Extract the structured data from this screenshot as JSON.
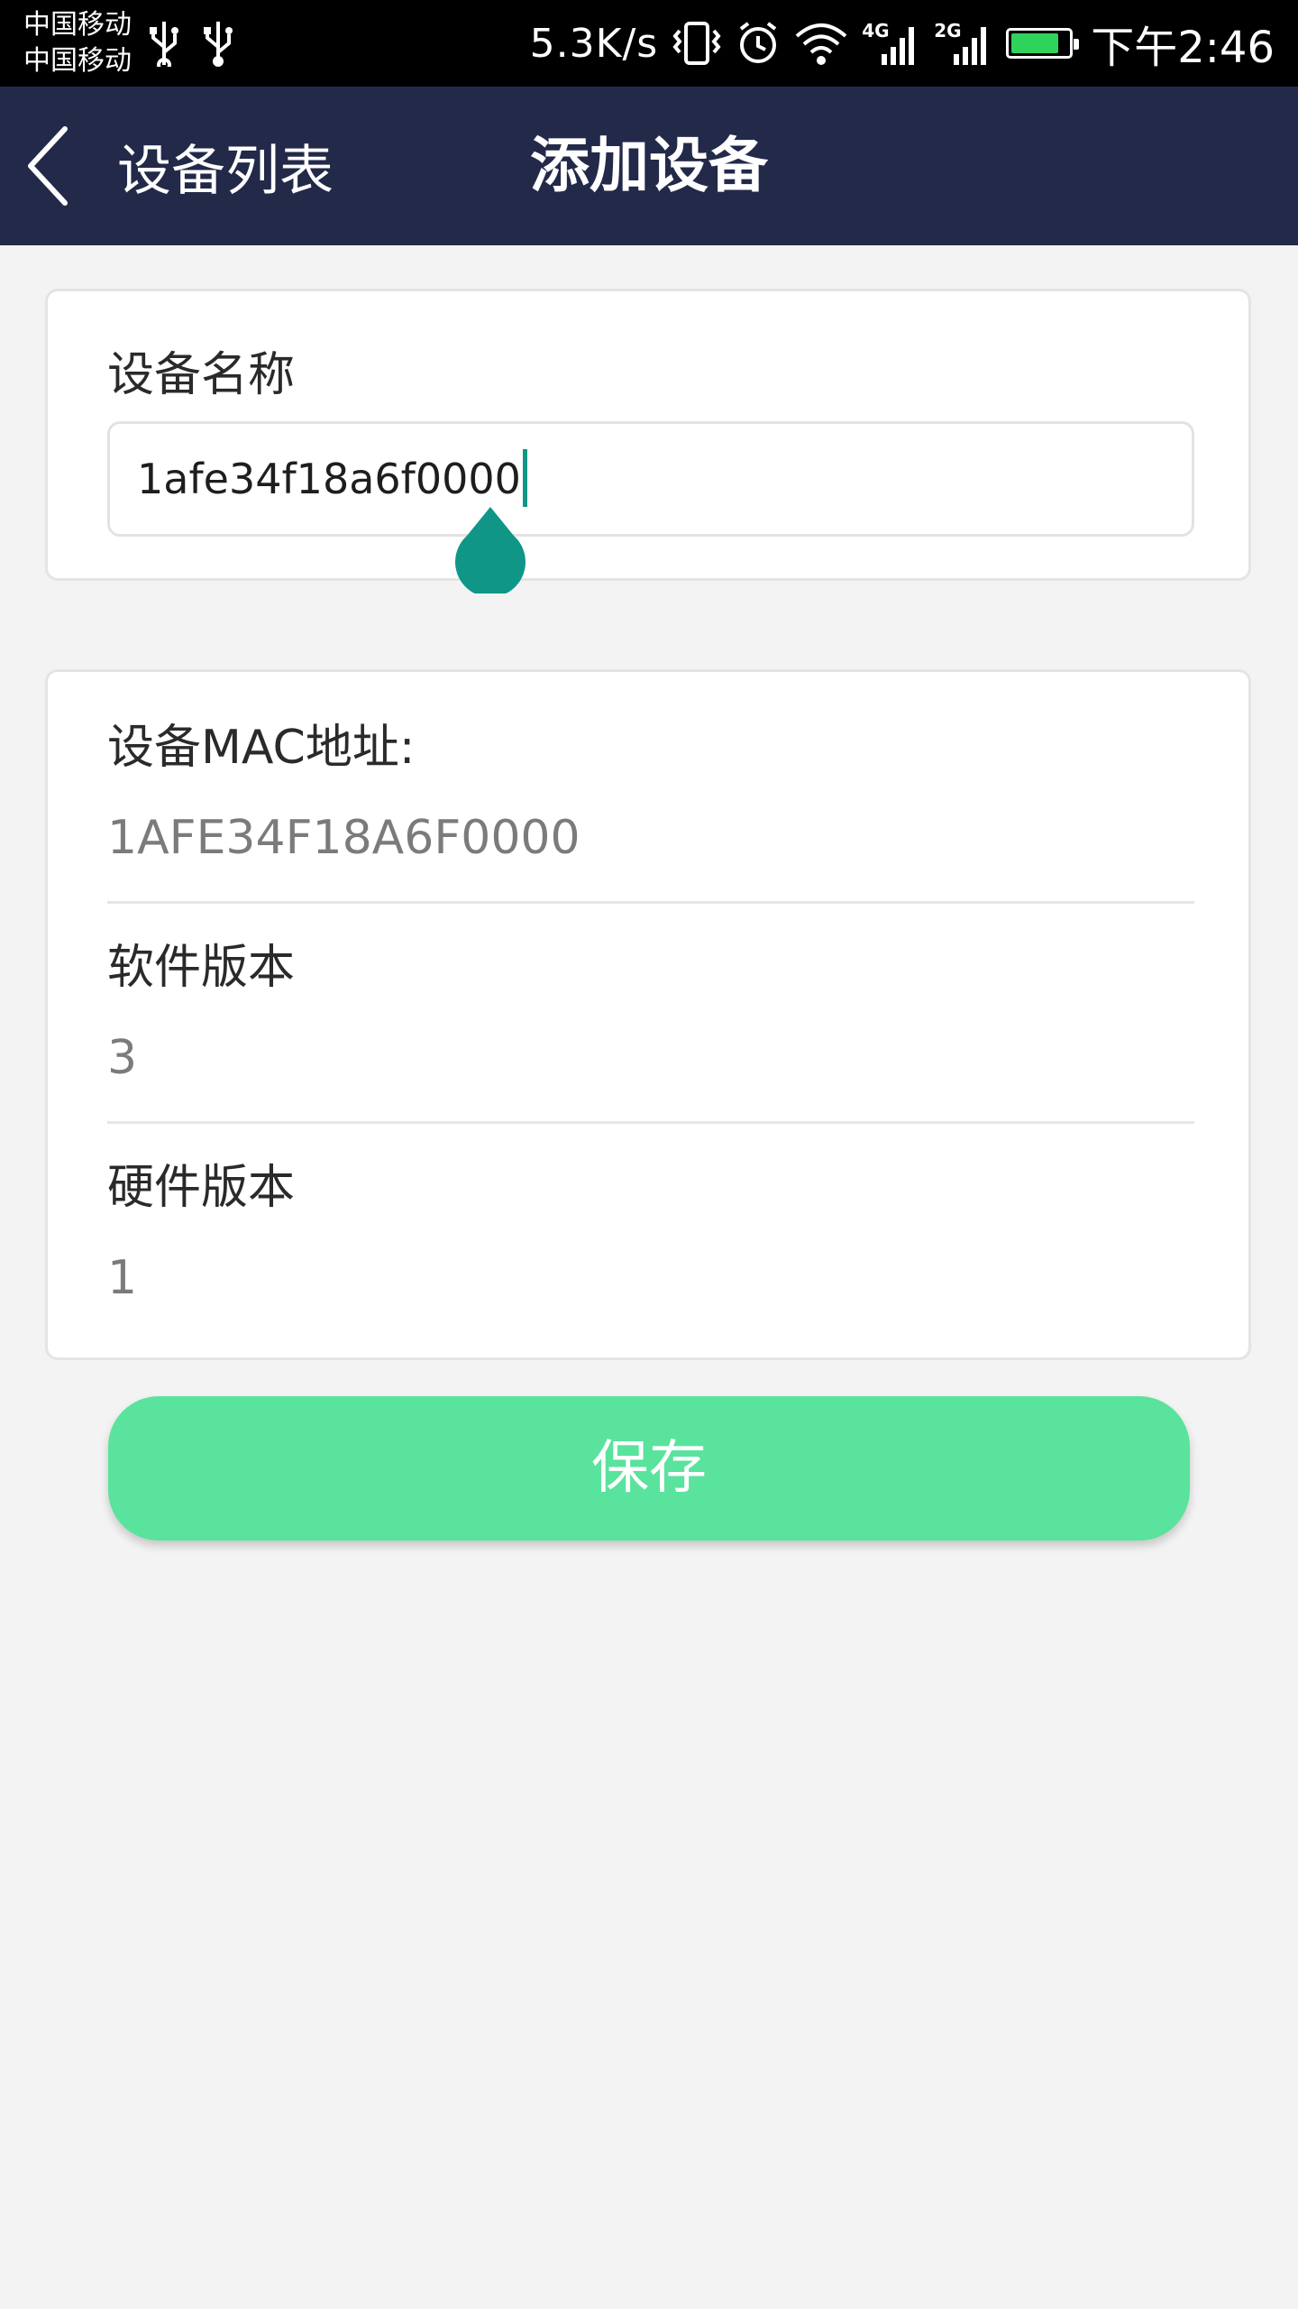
{
  "status_bar": {
    "carrier_1": "中国移动",
    "carrier_2": "中国移动",
    "net_speed": "5.3K/s",
    "signal_1_gen": "4G",
    "signal_2_gen": "2G",
    "time": "下午2:46",
    "battery_level": 0.85,
    "icons": [
      "usb-icon",
      "usb-icon",
      "vibrate-icon",
      "alarm-icon",
      "wifi-icon",
      "signal-icon",
      "signal-icon",
      "battery-charging-icon"
    ]
  },
  "app_bar": {
    "back_label": "设备列表",
    "title": "添加设备",
    "background": "#232949"
  },
  "device_name": {
    "label": "设备名称",
    "value": "1afe34f18a6f0000"
  },
  "device_info": {
    "mac_label": "设备MAC地址:",
    "mac_value": "1AFE34F18A6F0000",
    "software_label": "软件版本",
    "software_value": "3",
    "hardware_label": "硬件版本",
    "hardware_value": "1"
  },
  "save_button": {
    "label": "保存",
    "color": "#59e39c"
  },
  "colors": {
    "accent": "#0f9687",
    "page_background": "#f3f3f3"
  }
}
